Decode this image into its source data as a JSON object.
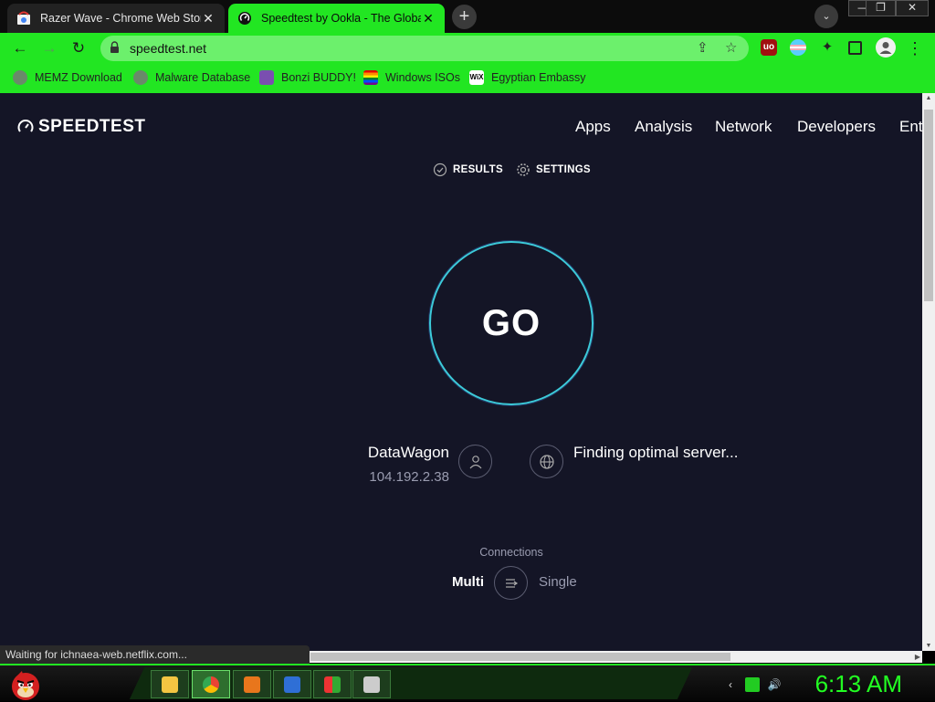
{
  "browser": {
    "tabs": [
      {
        "title": "Razer Wave - Chrome Web Store",
        "close": "✕"
      },
      {
        "title": "Speedtest by Ookla - The Global",
        "close": "✕"
      }
    ],
    "new_tab": "+",
    "tab_search": "⌄",
    "window_controls": {
      "minimize": "—",
      "maximize": "❐",
      "close": "✕"
    },
    "nav": {
      "back": "←",
      "forward": "→",
      "reload": "↻"
    },
    "url": "speedtest.net",
    "share_icon": "⇪",
    "star_icon": "☆",
    "menu_icon": "⋮",
    "bookmarks": [
      {
        "label": "MEMZ Download",
        "icon": "globe-icon"
      },
      {
        "label": "Malware Database",
        "icon": "globe-icon"
      },
      {
        "label": "Bonzi BUDDY!",
        "icon": "bonzi-icon"
      },
      {
        "label": "Windows ISOs",
        "icon": "windows-icon"
      },
      {
        "label": "Egyptian Embassy",
        "icon": "wix-icon"
      }
    ],
    "status": "Waiting for ichnaea-web.netflix.com..."
  },
  "page": {
    "logo": "SPEEDTEST",
    "nav": [
      "Apps",
      "Analysis",
      "Network",
      "Developers",
      "Ent"
    ],
    "subnav": {
      "results": "RESULTS",
      "settings": "SETTINGS"
    },
    "go": "GO",
    "isp": {
      "name": "DataWagon",
      "ip": "104.192.2.38"
    },
    "server": "Finding optimal server...",
    "connections": {
      "label": "Connections",
      "multi": "Multi",
      "single": "Single"
    }
  },
  "taskbar": {
    "clock": "6:13 AM"
  },
  "colors": {
    "accent": "#22e622",
    "page_bg": "#141526",
    "go_ring": "#3ccad9"
  }
}
